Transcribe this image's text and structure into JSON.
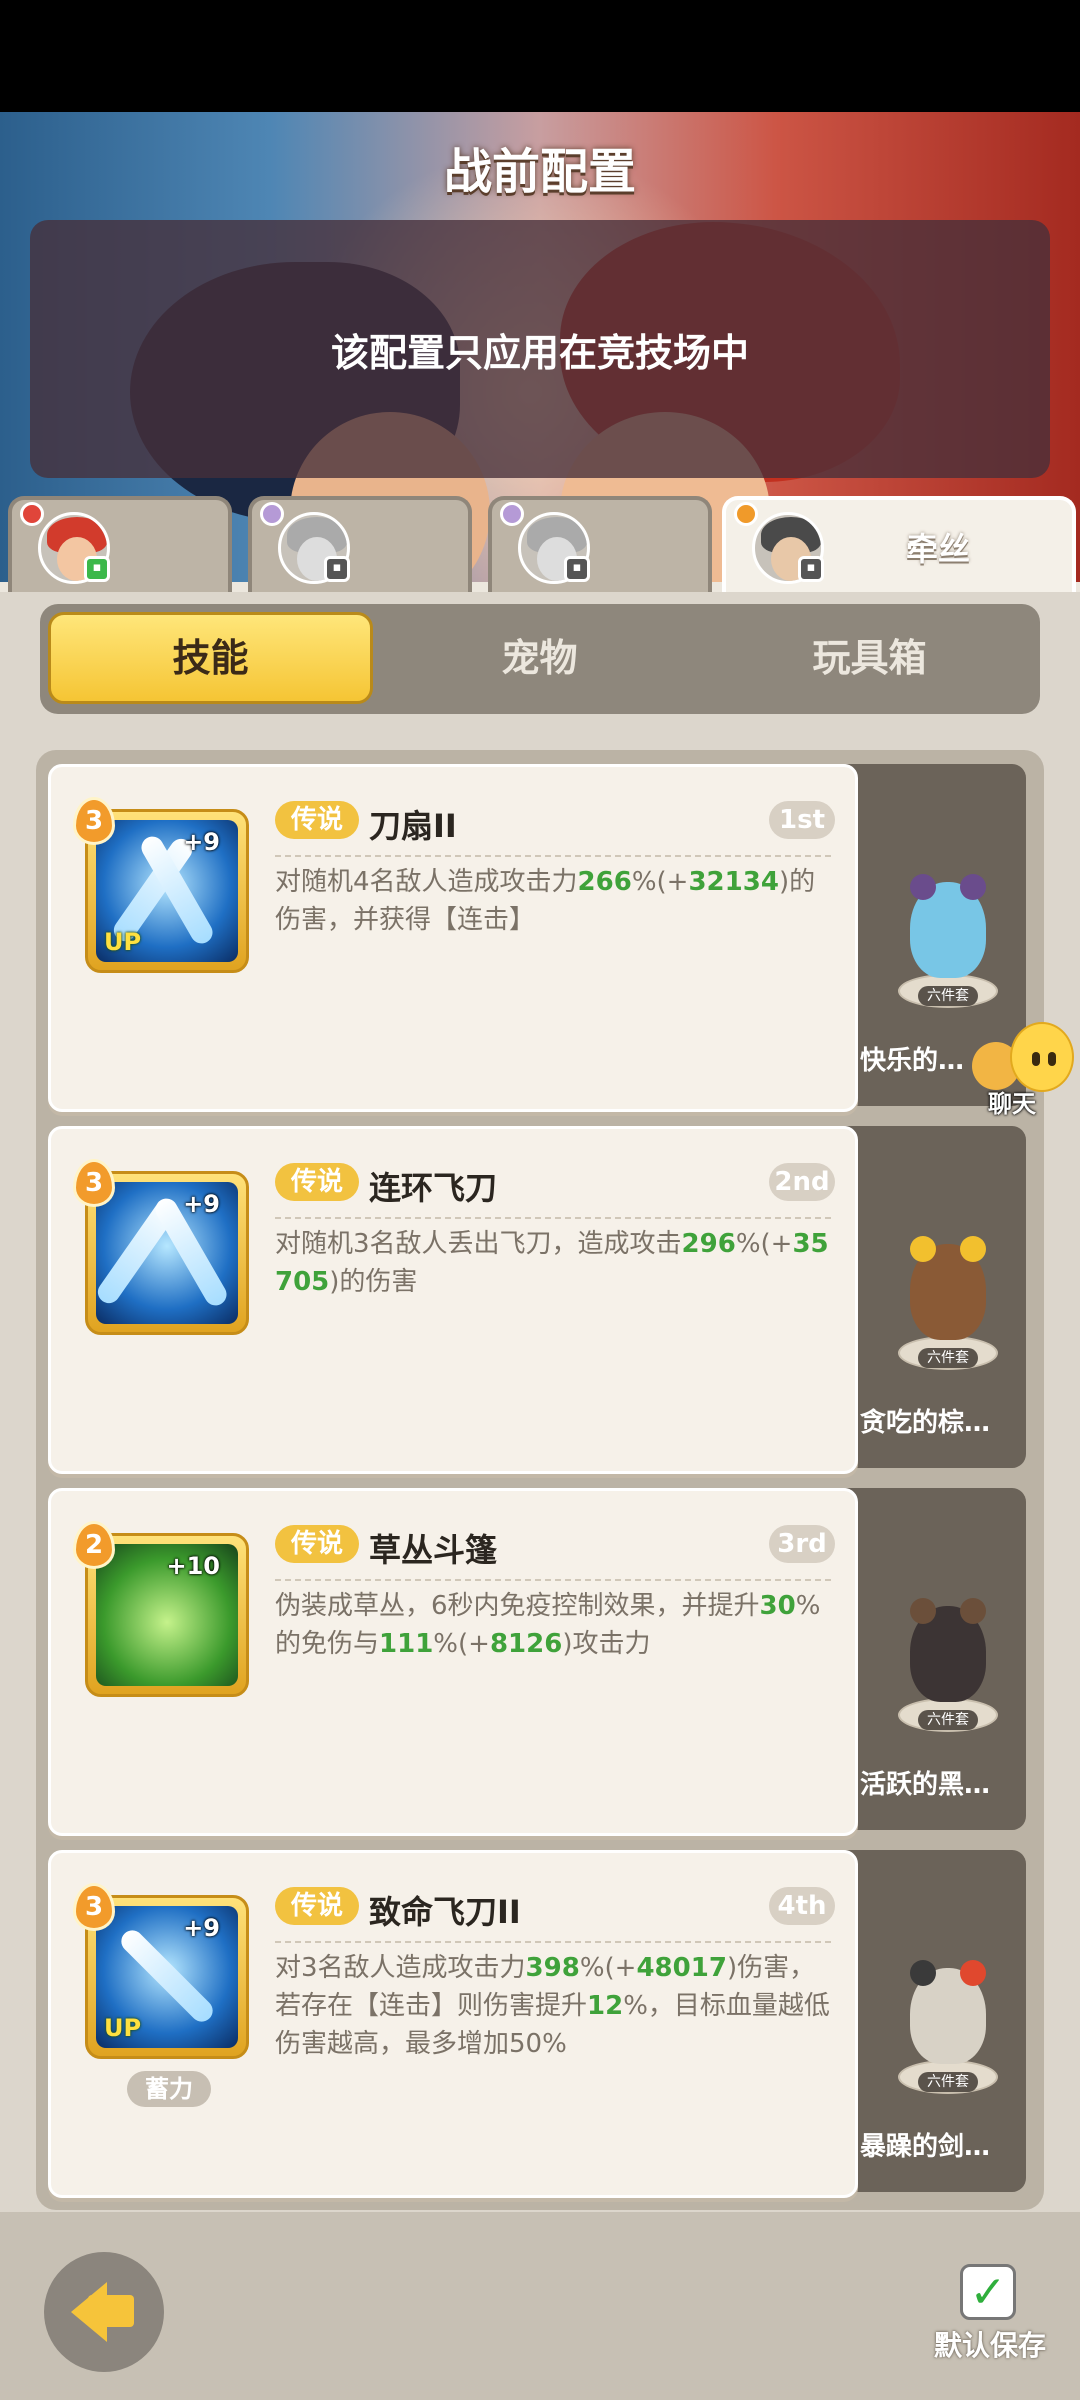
{
  "header": {
    "title": "战前配置",
    "notice": "该配置只应用在竞技场中"
  },
  "hero_tabs": [
    {
      "name": "",
      "active": false
    },
    {
      "name": "",
      "active": false
    },
    {
      "name": "",
      "active": false
    },
    {
      "name": "牵丝",
      "active": true
    }
  ],
  "segments": {
    "skills": "技能",
    "pets": "宠物",
    "toybox": "玩具箱",
    "active": "技能"
  },
  "skills": [
    {
      "rarity": "传说",
      "name": "刀扇II",
      "rank": "1st",
      "level": "3",
      "plus": "+9",
      "up": "UP",
      "desc": [
        "对随机4名敌人造成攻击力",
        "266",
        "%(+",
        "32134",
        ")的伤害，并获得【连击】"
      ],
      "pet": "快乐的…",
      "pet_tag": "六件套"
    },
    {
      "rarity": "传说",
      "name": "连环飞刀",
      "rank": "2nd",
      "level": "3",
      "plus": "+9",
      "up": "",
      "desc": [
        "对随机3名敌人丢出飞刀，造成攻击",
        "296",
        "%(+",
        "35705",
        ")的伤害"
      ],
      "pet": "贪吃的棕…",
      "pet_tag": "六件套"
    },
    {
      "rarity": "传说",
      "name": "草丛斗篷",
      "rank": "3rd",
      "level": "2",
      "plus": "+10",
      "up": "",
      "desc": [
        "伪装成草丛，6秒内免疫控制效果，并提升",
        "30",
        "%的免伤与",
        "111",
        "%(+",
        "8126",
        ")攻击力"
      ],
      "pet": "活跃的黑…",
      "pet_tag": "六件套"
    },
    {
      "rarity": "传说",
      "name": "致命飞刀II",
      "rank": "4th",
      "level": "3",
      "plus": "+9",
      "up": "UP",
      "desc": [
        "对3名敌人造成攻击力",
        "398",
        "%(+",
        "48017",
        ")伤害，若存在【连击】则伤害提升",
        "12",
        "%，目标血量越低伤害越高，最多增加50%"
      ],
      "charge": "蓄力",
      "pet": "暴躁的剑…",
      "pet_tag": "六件套"
    }
  ],
  "chat": {
    "label": "聊天"
  },
  "footer": {
    "save_label": "默认保存"
  },
  "colors": {
    "accent_yellow": "#f5c534",
    "legend_badge": "#f2c240",
    "highlight_green": "#3fa23a"
  }
}
